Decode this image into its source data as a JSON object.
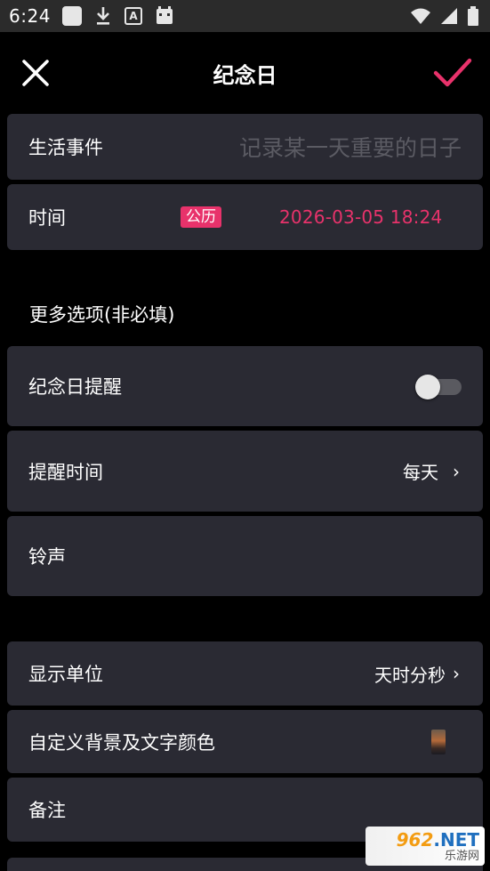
{
  "status_bar": {
    "time": "6:24"
  },
  "header": {
    "title": "纪念日"
  },
  "event": {
    "label": "生活事件",
    "placeholder": "记录某一天重要的日子"
  },
  "time_row": {
    "label": "时间",
    "calendar_badge": "公历",
    "datetime": "2026-03-05 18:24"
  },
  "more_options": {
    "title": "更多选项(非必填)"
  },
  "reminder": {
    "label": "纪念日提醒",
    "enabled": false
  },
  "reminder_time": {
    "label": "提醒时间",
    "value": "每天",
    "chevron": "›"
  },
  "ringtone": {
    "label": "铃声"
  },
  "display_unit": {
    "label": "显示单位",
    "value": "天时分秒",
    "chevron": "›"
  },
  "custom_bg": {
    "label": "自定义背景及文字颜色"
  },
  "note": {
    "label": "备注"
  },
  "watermark": {
    "brand_num": "962",
    "brand_suffix": ".NET",
    "subtitle": "乐游网"
  },
  "colors": {
    "accent": "#e8326b",
    "card": "#2a2a33",
    "background": "#000000",
    "placeholder": "#5b5b63"
  }
}
